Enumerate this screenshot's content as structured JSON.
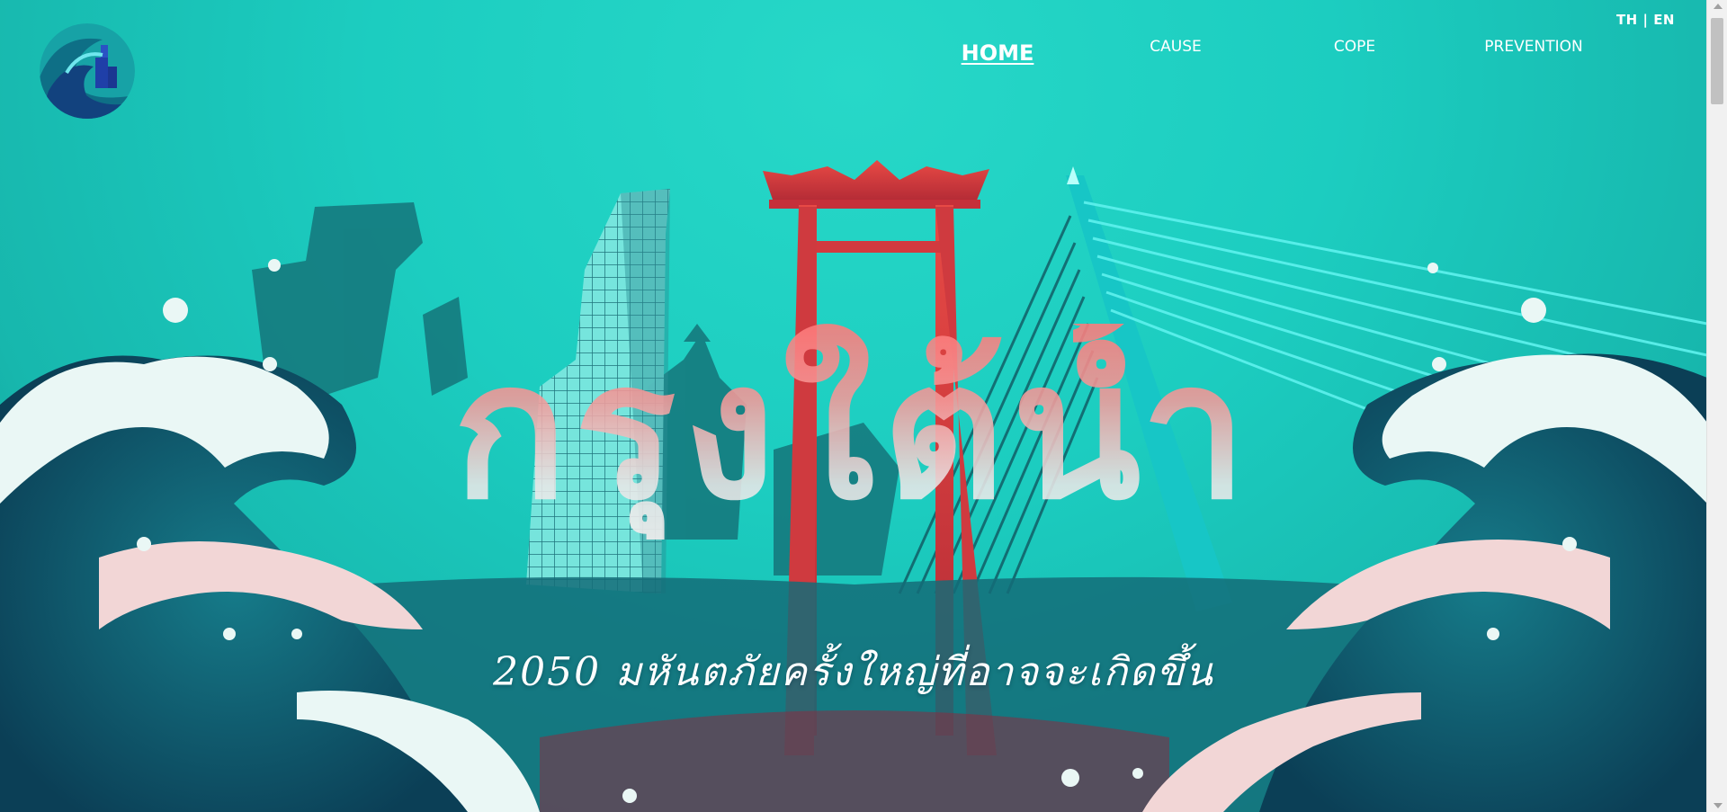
{
  "language_switch": {
    "th": "TH",
    "separator": "|",
    "en": "EN"
  },
  "nav": [
    {
      "label": "HOME",
      "active": true
    },
    {
      "label": "CAUSE",
      "active": false
    },
    {
      "label": "COPE",
      "active": false
    },
    {
      "label": "PREVENTION",
      "active": false
    }
  ],
  "hero": {
    "title": "กรุงใต้น้ำ",
    "subtitle": "2050 มหันตภัยครั้งใหญ่ที่อาจจะเกิดขึ้น"
  },
  "colors": {
    "background": "#1ccfc0",
    "accent_red": "#e0413d",
    "wave_dark": "#0b3f56",
    "foam": "#eaf7f5"
  },
  "icons": [
    "wave-logo-icon",
    "scroll-up-icon",
    "scroll-down-icon"
  ]
}
